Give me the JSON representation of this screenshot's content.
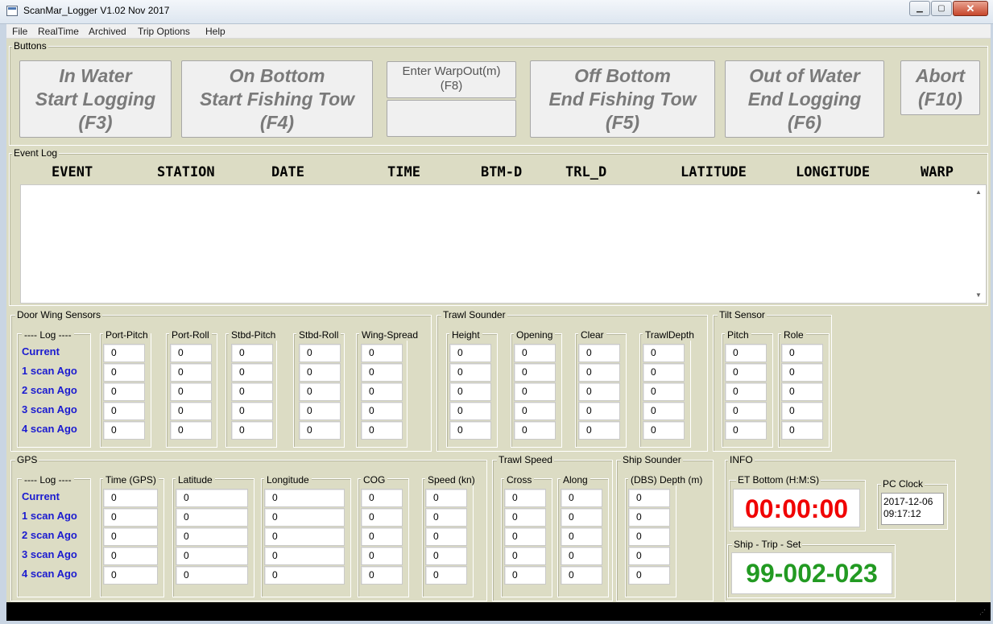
{
  "window": {
    "title": "ScanMar_Logger V1.02 Nov 2017",
    "minimize": "▁",
    "maximize": "▢",
    "close": "✕"
  },
  "menu": [
    "File",
    "RealTime",
    "Archived",
    "Trip Options",
    "Help"
  ],
  "buttons_group": {
    "title": "Buttons",
    "in_water": "In Water\nStart Logging\n(F3)",
    "on_bottom": "On Bottom\nStart Fishing Tow\n(F4)",
    "warp_out": "Enter WarpOut(m)\n(F8)",
    "off_bottom": "Off Bottom\nEnd Fishing Tow\n(F5)",
    "out_of_water": "Out of Water\nEnd Logging\n(F6)",
    "abort": "Abort\n(F10)"
  },
  "event_log": {
    "title": "Event Log",
    "columns": [
      "EVENT",
      "STATION",
      "DATE",
      "TIME",
      "BTM-D",
      "TRL_D",
      "LATITUDE",
      "LONGITUDE",
      "WARP"
    ]
  },
  "log_rows": [
    "---- Log ----",
    "Current",
    "1 scan Ago",
    "2 scan Ago",
    "3 scan Ago",
    "4 scan Ago"
  ],
  "door_wing": {
    "title": "Door  Wing Sensors",
    "columns": [
      "Port-Pitch",
      "Port-Roll",
      "Stbd-Pitch",
      "Stbd-Roll",
      "Wing-Spread"
    ]
  },
  "trawl_sounder": {
    "title": "Trawl Sounder",
    "columns": [
      "Height",
      "Opening",
      "Clear",
      "TrawlDepth"
    ]
  },
  "tilt_sensor": {
    "title": "Tilt Sensor",
    "columns": [
      "Pitch",
      "Role"
    ]
  },
  "gps": {
    "title": "GPS",
    "columns": [
      "Time (GPS)",
      "Latitude",
      "Longitude",
      "COG",
      "Speed (kn)"
    ]
  },
  "trawl_speed": {
    "title": "Trawl Speed",
    "columns": [
      "Cross",
      "Along"
    ]
  },
  "ship_sounder": {
    "title": "Ship Sounder",
    "columns": [
      "(DBS) Depth (m)"
    ]
  },
  "cell_value": "0",
  "info": {
    "title": "INFO",
    "et_bottom_label": "ET Bottom (H:M:S)",
    "et_bottom_value": "00:00:00",
    "pc_clock_label": "PC Clock",
    "pc_date": "2017-12-06",
    "pc_time": "09:17:12",
    "ship_trip_set_label": "Ship - Trip - Set",
    "ship_trip_set_value": "99-002-023"
  },
  "colors": {
    "background": "#dcdcc4",
    "log_label": "#1b1bd0",
    "et_value": "#f00000",
    "sts_value": "#229a22"
  }
}
